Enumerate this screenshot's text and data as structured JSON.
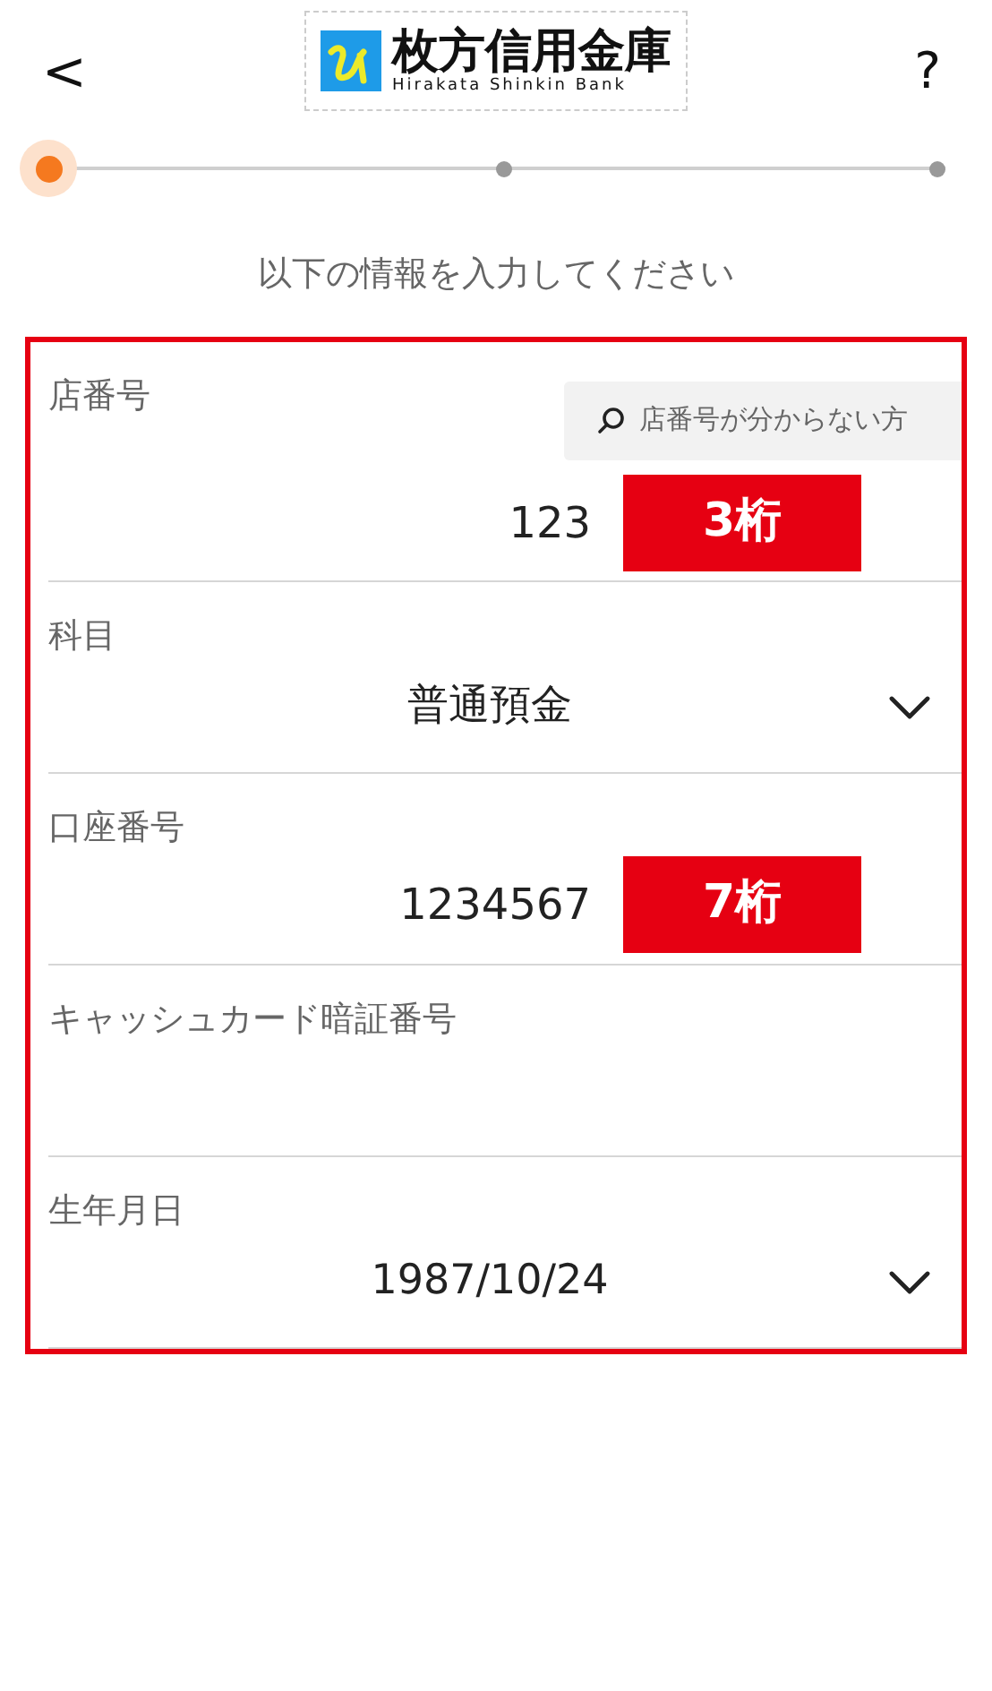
{
  "header": {
    "back": "<",
    "help": "?",
    "logo": {
      "name": "枚方信用金庫",
      "subtitle": "Hirakata Shinkin Bank"
    }
  },
  "progress": [
    {
      "selected": true
    },
    {
      "selected": false
    },
    {
      "selected": false
    }
  ],
  "instruction": "以下の情報を入力してください",
  "fields": [
    {
      "kind": "input",
      "label": "店番号",
      "value": "123",
      "badge": "3桁",
      "help_button": "店番号が分からない方"
    },
    {
      "kind": "select",
      "label": "科目",
      "value": "普通預金"
    },
    {
      "kind": "input",
      "label": "口座番号",
      "value": "1234567",
      "badge": "7桁"
    },
    {
      "kind": "input",
      "label": "キャッシュカード暗証番号"
    },
    {
      "kind": "select",
      "label": "生年月日",
      "value": "1987/10/24"
    }
  ]
}
